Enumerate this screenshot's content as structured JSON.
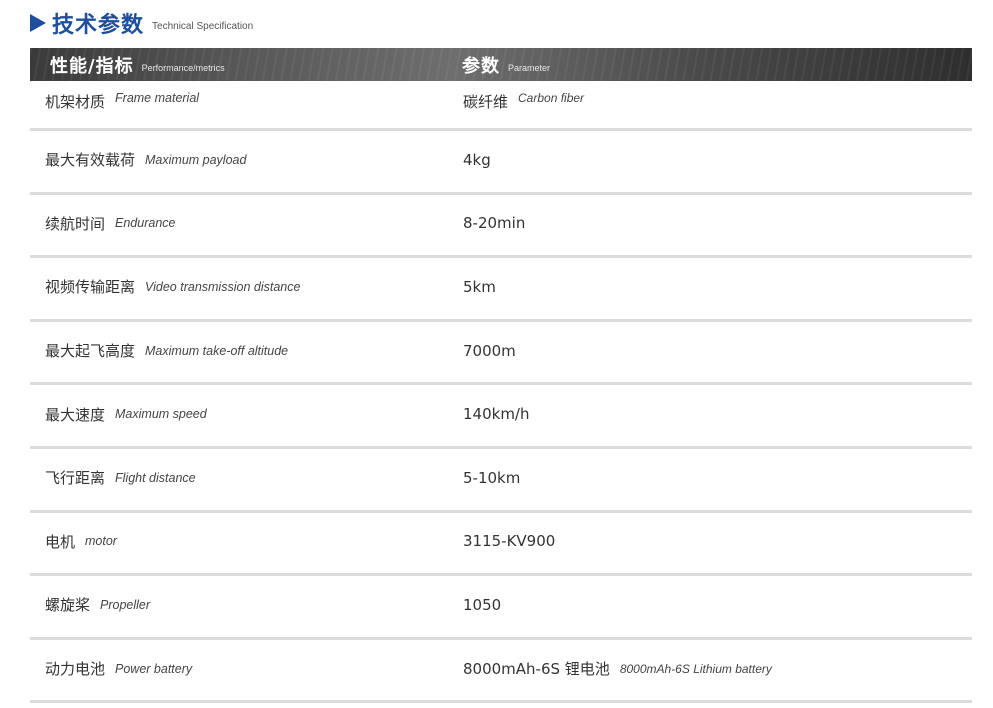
{
  "header": {
    "title_cn": "技术参数",
    "title_en": "Technical Specification"
  },
  "table": {
    "columns": [
      {
        "cn": "性能/指标",
        "en": "Performance/metrics"
      },
      {
        "cn": "参数",
        "en": "Parameter"
      }
    ],
    "rows": [
      {
        "metric_cn": "机架材质",
        "metric_en": "Frame material",
        "value": "碳纤维",
        "value_en": "Carbon fiber"
      },
      {
        "metric_cn": "最大有效载荷",
        "metric_en": "Maximum payload",
        "value": "4kg",
        "value_en": ""
      },
      {
        "metric_cn": "续航时间",
        "metric_en": "Endurance",
        "value": "8-20min",
        "value_en": ""
      },
      {
        "metric_cn": "视频传输距离",
        "metric_en": "Video transmission distance",
        "value": "5km",
        "value_en": ""
      },
      {
        "metric_cn": "最大起飞高度",
        "metric_en": "Maximum take-off altitude",
        "value": "7000m",
        "value_en": ""
      },
      {
        "metric_cn": "最大速度",
        "metric_en": "Maximum speed",
        "value": "140km/h",
        "value_en": ""
      },
      {
        "metric_cn": "飞行距离",
        "metric_en": "Flight distance",
        "value": "5-10km",
        "value_en": ""
      },
      {
        "metric_cn": "电机",
        "metric_en": "motor",
        "value": "3115-KV900",
        "value_en": ""
      },
      {
        "metric_cn": "螺旋桨",
        "metric_en": "Propeller",
        "value": "1050",
        "value_en": ""
      },
      {
        "metric_cn": "动力电池",
        "metric_en": "Power battery",
        "value": "8000mAh-6S 锂电池",
        "value_en": "8000mAh-6S Lithium battery"
      }
    ]
  },
  "colors": {
    "accent": "#1d4f9c",
    "header_dark": "#3a3a3a",
    "row_divider": "#dcdcdc"
  },
  "icons": {
    "title_marker": "triangle-right-icon"
  }
}
